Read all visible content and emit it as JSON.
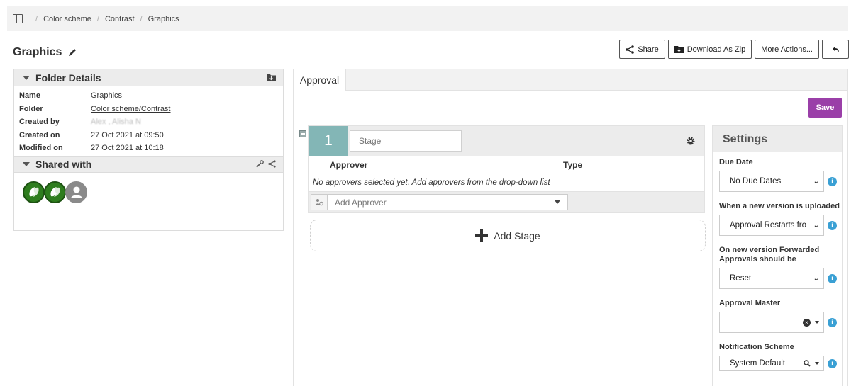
{
  "breadcrumb": {
    "items": [
      "Color scheme",
      "Contrast",
      "Graphics"
    ],
    "separator": "/"
  },
  "page": {
    "title": "Graphics"
  },
  "toolbar": {
    "share_label": "Share",
    "download_label": "Download As Zip",
    "more_label": "More Actions..."
  },
  "folder_details": {
    "title": "Folder Details",
    "rows": [
      {
        "label": "Name",
        "value": "Graphics"
      },
      {
        "label": "Folder",
        "value": "Color scheme/Contrast"
      },
      {
        "label": "Created by",
        "value": "Alex , Alisha N"
      },
      {
        "label": "Created on",
        "value": "27 Oct 2021 at 09:50"
      },
      {
        "label": "Modified on",
        "value": "27 Oct 2021 at 10:18"
      }
    ]
  },
  "shared_with": {
    "title": "Shared with"
  },
  "tabs": {
    "approval": "Approval"
  },
  "save_label": "Save",
  "stage": {
    "number": "1",
    "placeholder": "Stage",
    "col_approver": "Approver",
    "col_type": "Type",
    "empty_text": "No approvers selected yet. Add approvers from the drop-down list",
    "add_approver_placeholder": "Add Approver"
  },
  "add_stage_label": "Add Stage",
  "settings": {
    "title": "Settings",
    "due_date_label": "Due Date",
    "due_date_value": "No Due Dates",
    "new_version_label": "When a new version is uploaded",
    "new_version_value": "Approval Restarts fro",
    "forwarded_label": "On new version Forwarded Approvals should be",
    "forwarded_value": "Reset",
    "master_label": "Approval Master",
    "master_value": "",
    "notification_label": "Notification Scheme",
    "notification_value": "System Default"
  },
  "colors": {
    "save_button": "#9a3fa8",
    "stage_number": "#83b6b6",
    "info_icon": "#3aa0d4",
    "avatar_green": "#2e7d1e"
  }
}
